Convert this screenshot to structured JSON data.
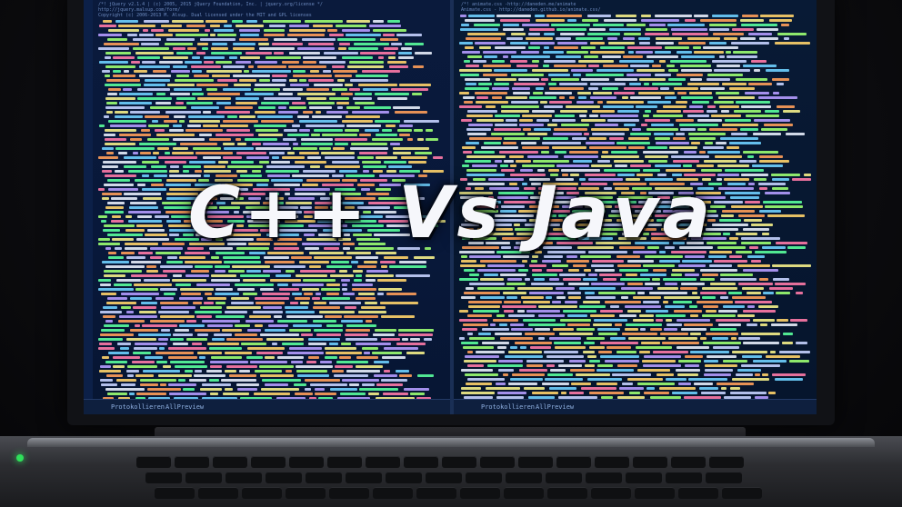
{
  "headline": "C++ Vs Java",
  "left_editor": {
    "header_lines": [
      "/*! jQuery v2.1.4 | (c) 2005, 2015 jQuery Foundation, Inc. | jquery.org/license */",
      "http://jquery.malsup.com/form/",
      "Copyright (c) 2006-2013  M. Alsup. Dual licensed under the MIT and GPL licenses"
    ],
    "status_items": [
      "Protokollieren",
      "AllPreview"
    ]
  },
  "right_editor": {
    "header_lines": [
      "/*! animate.css -http://daneden.me/animate",
      "Animate.css - http://daneden.github.io/animate.css/"
    ],
    "status_items": [
      "Protokollieren",
      "AllPreview"
    ]
  },
  "colors": {
    "screen_bg": "#07142e",
    "title": "#f6f7fb",
    "code_palette": [
      "#6fd0ff",
      "#9cff72",
      "#ffd36a",
      "#ff7aa8",
      "#c7d3ff",
      "#5aff9d",
      "#f5f08a",
      "#ff9f5a",
      "#b59cff",
      "#e8eefc"
    ]
  },
  "icons": [
    "power-led-icon",
    "keyboard-keys"
  ]
}
